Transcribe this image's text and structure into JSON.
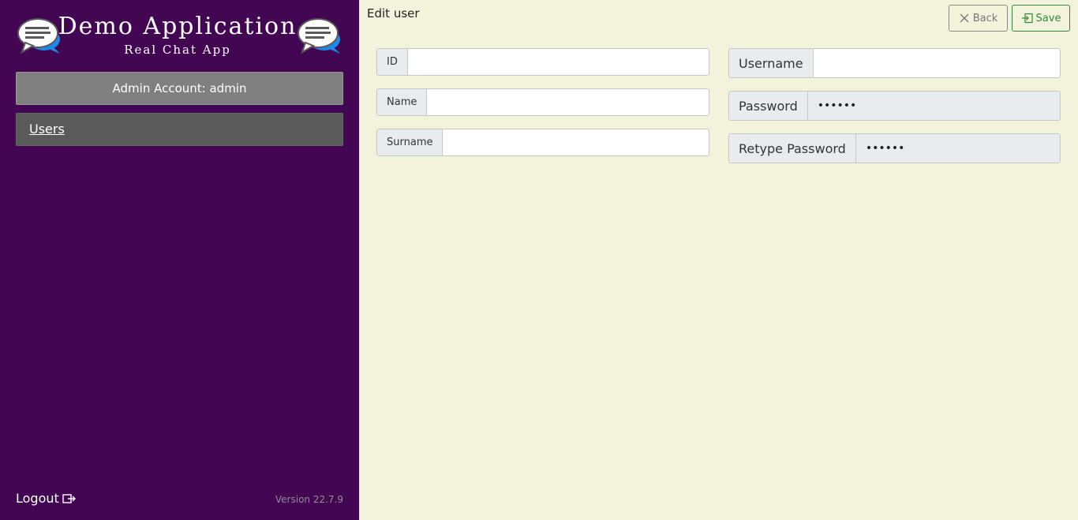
{
  "sidebar": {
    "brand_title": "Demo Application",
    "brand_subtitle": "Real Chat App",
    "account_label": "Admin Account: admin",
    "nav_items": [
      {
        "label": "Users"
      }
    ],
    "logout_label": "Logout",
    "version": "Version 22.7.9"
  },
  "main": {
    "page_title": "Edit user",
    "back_label": "Back",
    "save_label": "Save",
    "left_fields": [
      {
        "label": "ID",
        "value": ""
      },
      {
        "label": "Name",
        "value": ""
      },
      {
        "label": "Surname",
        "value": ""
      }
    ],
    "right_fields": [
      {
        "label": "Username",
        "value": ""
      },
      {
        "label": "Password",
        "value": "••••••"
      },
      {
        "label": "Retype Password",
        "value": "••••••"
      }
    ]
  },
  "colors": {
    "sidebar_bg": "#430653",
    "main_bg": "#f3f3dc",
    "save_accent": "#2f8a3a"
  },
  "icons": {
    "logo": "chat-bubble-icon",
    "back": "close-icon",
    "save": "sign-in-icon",
    "logout": "logout-icon"
  }
}
